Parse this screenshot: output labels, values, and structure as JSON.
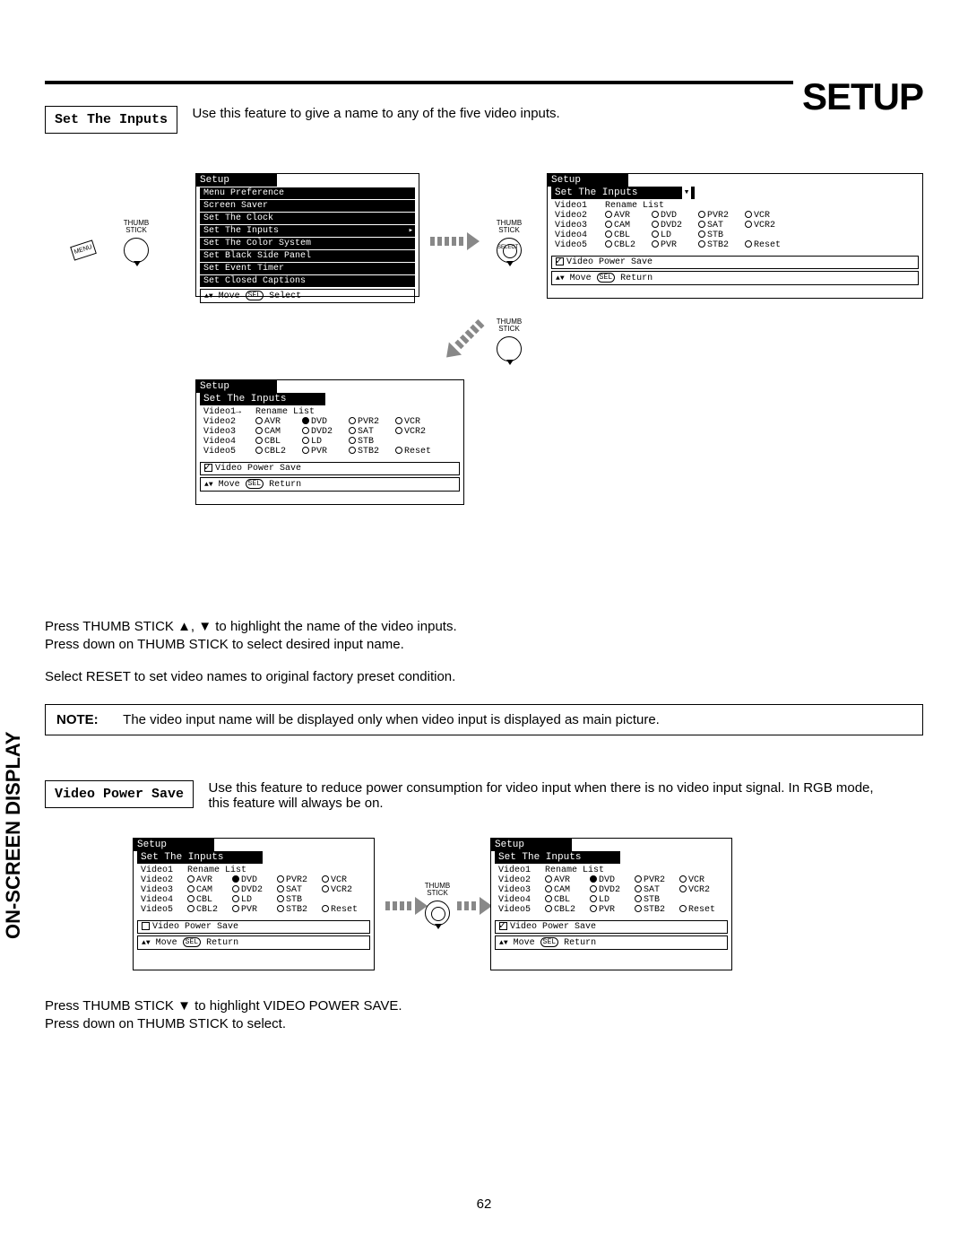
{
  "header": {
    "title": "SETUP"
  },
  "side_tab": "On-Screen Display",
  "page_number": "62",
  "section_set_inputs": {
    "label": "Set The Inputs",
    "desc": "Use this feature to give a name to any of the five video inputs."
  },
  "section_video_power": {
    "label": "Video Power Save",
    "desc": "Use this feature to reduce power consumption for video input when there is no video input signal.  In RGB mode, this feature will always be on."
  },
  "instructions": {
    "i1a": "Press THUMB STICK ▲, ▼ to highlight the name of the video inputs.",
    "i1b": "Press down on THUMB STICK to select desired input name.",
    "i1c": "Select RESET to set video names to original factory preset condition.",
    "i2a": "Press THUMB STICK ▼ to highlight VIDEO POWER SAVE.",
    "i2b": "Press down on THUMB STICK to select."
  },
  "note": {
    "label": "NOTE:",
    "text": "The video input name will be displayed only when video input is displayed as main picture."
  },
  "osd_menu": {
    "title": "Setup",
    "items": [
      "Menu Preference",
      "Screen Saver",
      "Set The Clock",
      "Set The Inputs",
      "Set The Color System",
      "Set Black Side Panel",
      "Set Event Timer",
      "Set Closed Captions"
    ],
    "highlight_index": 3,
    "footer_move": "Move",
    "footer_sel": "SEL",
    "footer_select": "Select"
  },
  "osd_inputs": {
    "title": "Setup",
    "subtitle": "Set The Inputs",
    "videos": [
      "Video1",
      "Video2",
      "Video3",
      "Video4",
      "Video5"
    ],
    "rename_header": "Rename List",
    "options": [
      [
        "AVR",
        "DVD",
        "PVR2",
        "VCR"
      ],
      [
        "CAM",
        "DVD2",
        "SAT",
        "VCR2"
      ],
      [
        "CBL",
        "LD",
        "STB",
        ""
      ],
      [
        "CBL2",
        "PVR",
        "STB2",
        "Reset"
      ]
    ],
    "power_save": "Video Power Save",
    "footer_move": "Move",
    "footer_sel": "SEL",
    "footer_return": "Return"
  },
  "thumbstick": {
    "label": "THUMB\nSTICK",
    "select": "SELECT",
    "menu": "MENU"
  }
}
